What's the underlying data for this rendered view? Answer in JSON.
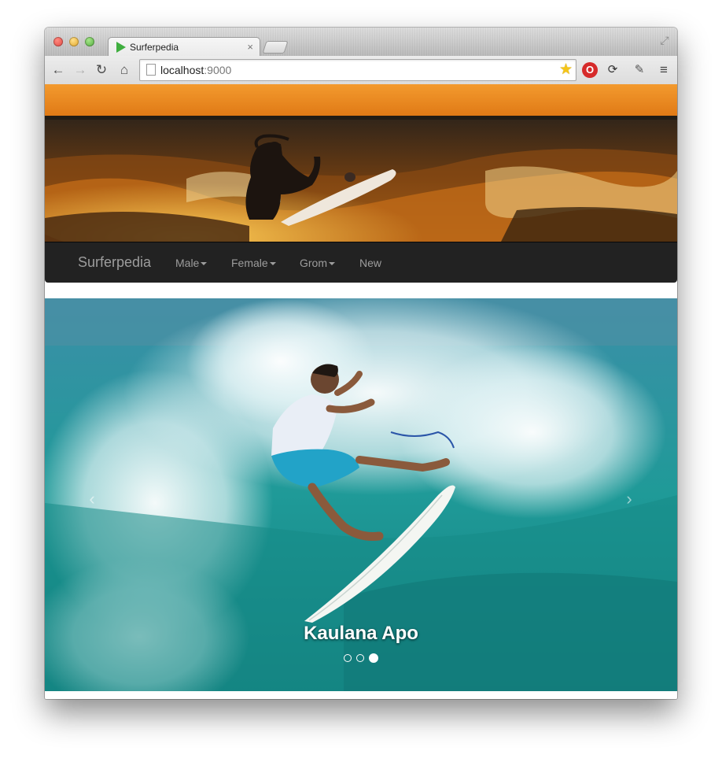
{
  "browser": {
    "tab_title": "Surferpedia",
    "tab_close": "×",
    "url_host": "localhost",
    "url_port": ":9000"
  },
  "icons": {
    "back": "arrow-left-icon",
    "forward": "arrow-right-icon",
    "reload": "reload-icon",
    "home": "home-icon",
    "star": "star-icon",
    "extension_1": "opera-icon",
    "extension_2": "sync-icon",
    "extension_3": "eyedropper-icon",
    "menu": "hamburger-menu-icon"
  },
  "navbar": {
    "brand": "Surferpedia",
    "items": [
      {
        "label": "Male",
        "dropdown": true
      },
      {
        "label": "Female",
        "dropdown": true
      },
      {
        "label": "Grom",
        "dropdown": true
      },
      {
        "label": "New",
        "dropdown": false
      }
    ]
  },
  "carousel": {
    "caption": "Kaulana Apo",
    "prev_glyph": "‹",
    "next_glyph": "›",
    "slide_count": 3,
    "active_index": 2
  },
  "colors": {
    "navbar_bg": "#222222",
    "navbar_text": "#9d9d9d",
    "caption_text": "#ffffff"
  }
}
